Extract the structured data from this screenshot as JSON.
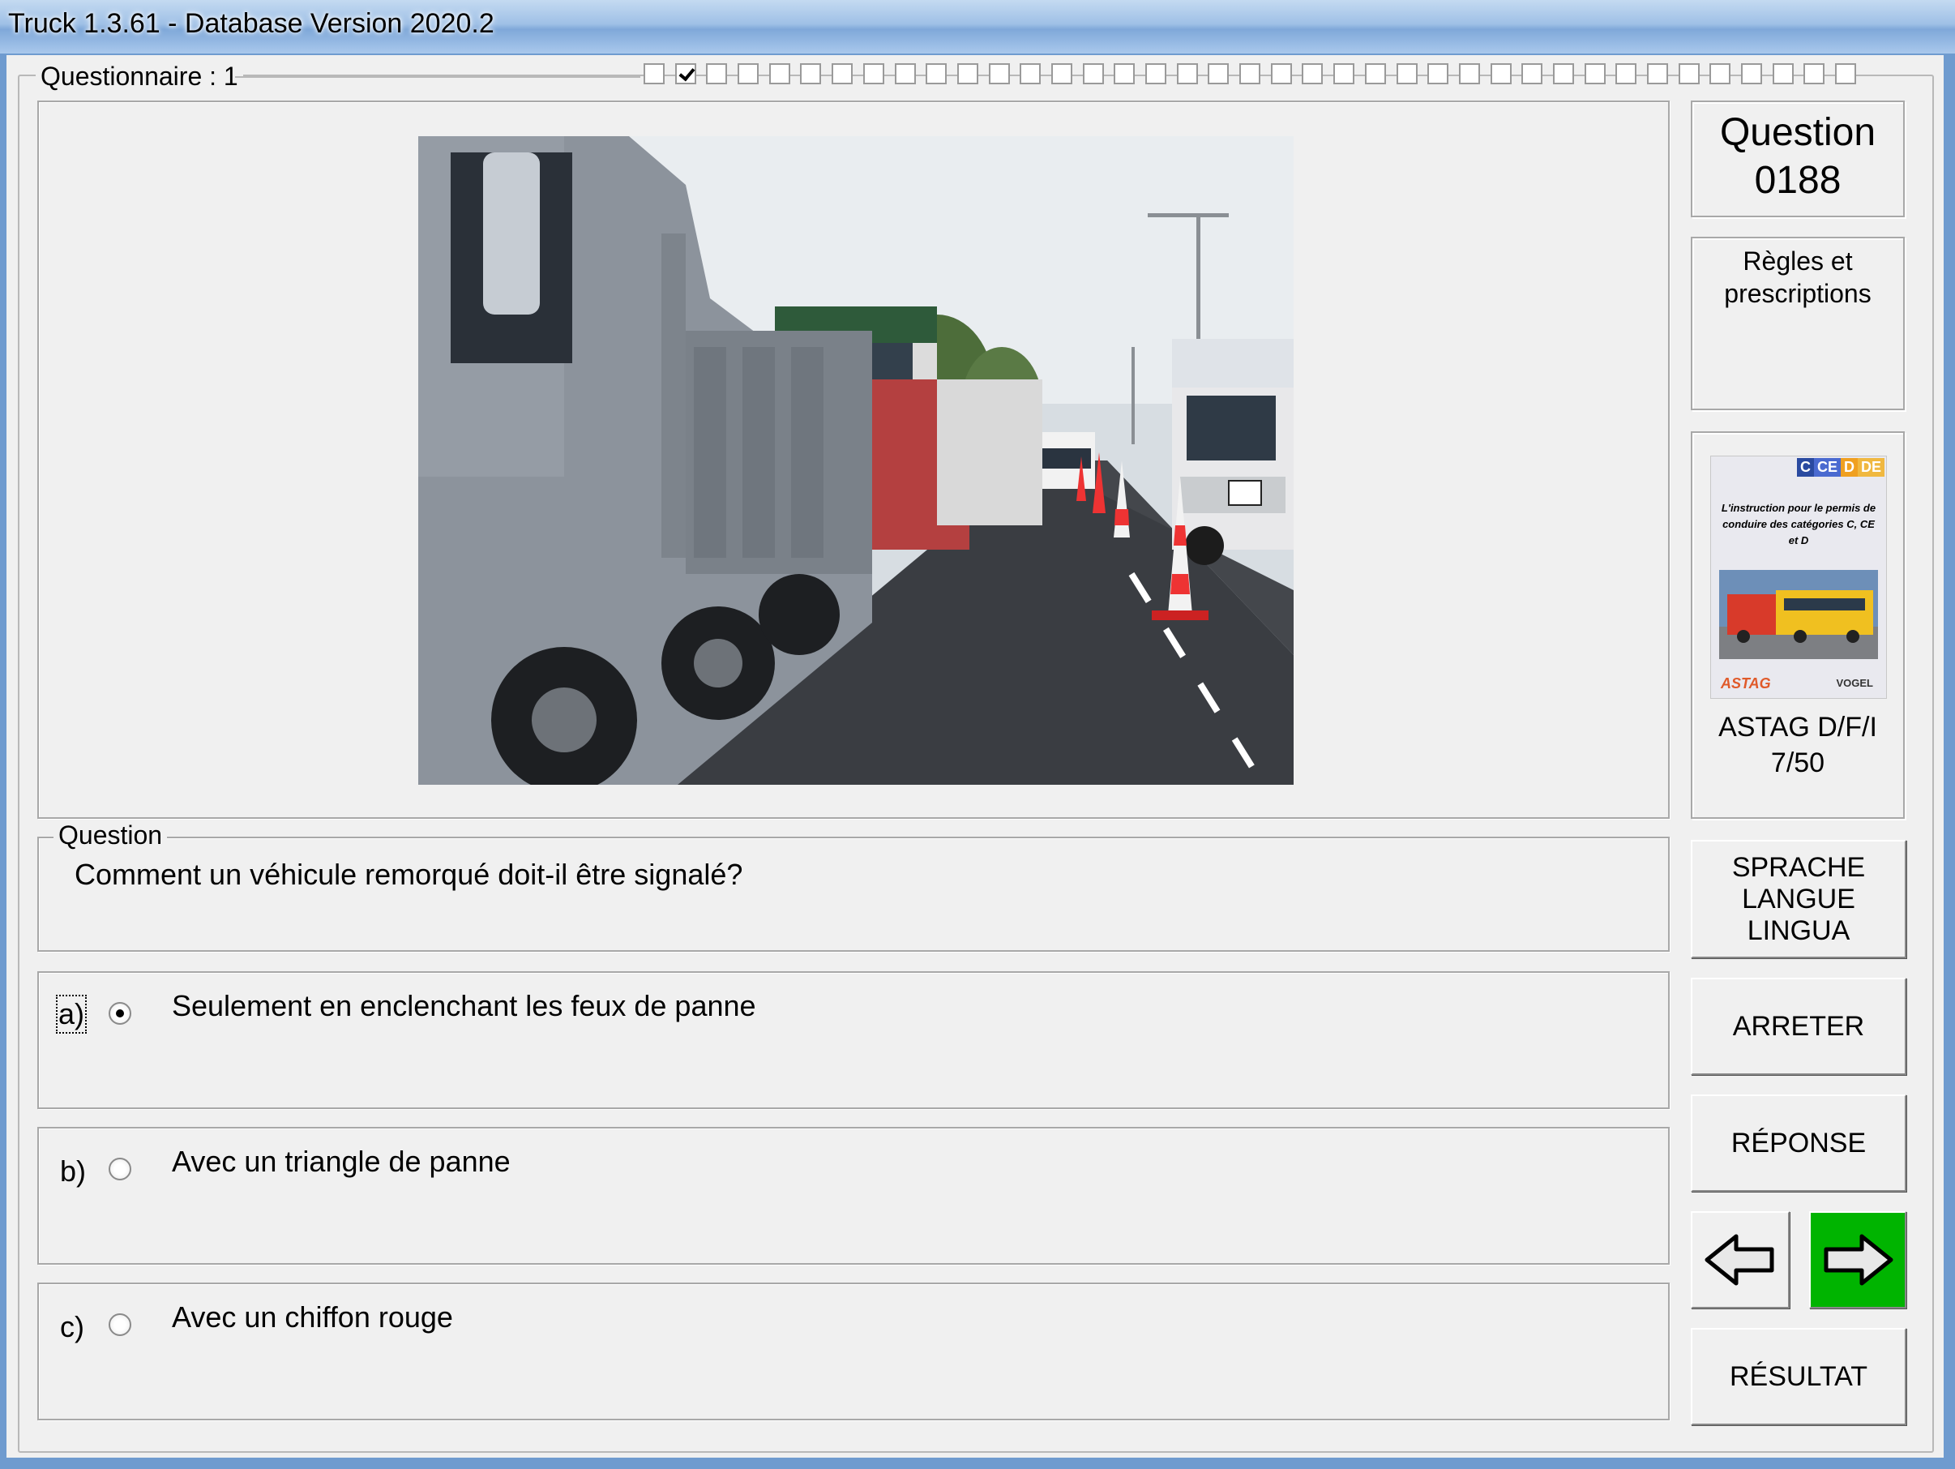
{
  "window": {
    "title": "Truck 1.3.61 - Database Version 2020.2"
  },
  "questionnaire": {
    "label": "Questionnaire : 1",
    "progress": {
      "total": 39,
      "checked_index": 1
    }
  },
  "question_panel": {
    "label": "Question",
    "text": "Comment un véhicule remorqué doit-il être signalé?"
  },
  "answers": [
    {
      "letter": "a)",
      "text": "Seulement en enclenchant les feux de panne",
      "selected": true
    },
    {
      "letter": "b)",
      "text": "Avec un triangle de panne",
      "selected": false
    },
    {
      "letter": "c)",
      "text": "Avec un chiffon rouge",
      "selected": false
    }
  ],
  "side": {
    "question_title": "Question",
    "question_number": "0188",
    "category": "Règles et prescriptions",
    "book": {
      "badges": [
        "C",
        "CE",
        "D",
        "DE"
      ],
      "description": "L'instruction pour le permis de conduire des catégories C, CE et D",
      "publisher_logo": "ASTAG",
      "brand": "VOGEL"
    },
    "source": "ASTAG D/F/I",
    "source_page": "7/50"
  },
  "buttons": {
    "language": "SPRACHE\nLANGUE\nLINGUA",
    "stop": "ARRETER",
    "answer": "RÉPONSE",
    "result": "RÉSULTAT",
    "prev_icon": "arrow-left-icon",
    "next_icon": "arrow-right-icon"
  },
  "colors": {
    "next_button": "#00b400",
    "window_frame": "#6f9bcf"
  }
}
